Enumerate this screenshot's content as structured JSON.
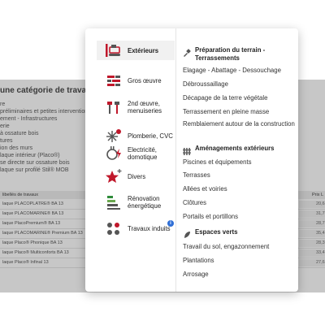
{
  "background": {
    "title": "une catégorie de travaux ci-d",
    "items": [
      "re",
      "préliminaires et petites intervention",
      "ement - Infrastructures",
      "erie",
      "à ossature bois",
      "tures",
      "ion des murs",
      "laque intérieur (Placo®)",
      "se directe sur ossature bois",
      "laque sur profilé Stil® MOB"
    ],
    "table_header": "libellés de travaux",
    "table_header_right": "Prix L",
    "rows": [
      {
        "name": "laque PLACOPLATRE® BA 13",
        "price": "20,6"
      },
      {
        "name": "laque PLACOMARINE® BA 13",
        "price": "31,7"
      },
      {
        "name": "laque PlacoPremium® BA 13",
        "price": "28,7"
      },
      {
        "name": "laque PLACOMARINE® Premium BA 13",
        "price": "35,4"
      },
      {
        "name": "laque Placo® Phonique BA 13",
        "price": "28,3"
      },
      {
        "name": "laque Placo® Multiconforts BA 13",
        "price": "33,4"
      },
      {
        "name": "laque Placo® Infinal 13",
        "price": "27,6"
      }
    ]
  },
  "menu": {
    "categories": [
      {
        "label": "Extérieurs",
        "icon": "excavator-icon",
        "active": true
      },
      {
        "label": "Gros œuvre",
        "icon": "bricks-icon"
      },
      {
        "label": "2nd œuvre, menuiseries",
        "icon": "tools-icon"
      },
      {
        "label": "Plomberie, CVC",
        "icon": "snowflake-sun-icon"
      },
      {
        "label": "Electricité, domotique",
        "icon": "plug-icon"
      },
      {
        "label": "Divers",
        "icon": "star-icon"
      },
      {
        "label": "Rénovation énergétique",
        "icon": "energy-bars-icon"
      },
      {
        "label": "Travaux induits",
        "icon": "dots-grid-icon",
        "badge": "i"
      }
    ],
    "sections": [
      {
        "title": "Préparation du terrain - Terrassements",
        "icon": "shovel-icon",
        "items": [
          "Elagage - Abattage - Dessouchage",
          "Débroussaillage",
          "Décapage de la terre végétale",
          "Terrassement en pleine masse",
          "Remblaiement autour de la construction"
        ]
      },
      {
        "title": "Aménagements extérieurs",
        "icon": "fence-icon",
        "items": [
          "Piscines et équipements",
          "Terrasses",
          "Allées et voiries",
          "Clôtures",
          "Portails et portillons"
        ]
      },
      {
        "title": "Espaces verts",
        "icon": "leaf-icon",
        "items": [
          "Travail du sol, engazonnement",
          "Plantations",
          "Arrosage"
        ]
      }
    ]
  }
}
